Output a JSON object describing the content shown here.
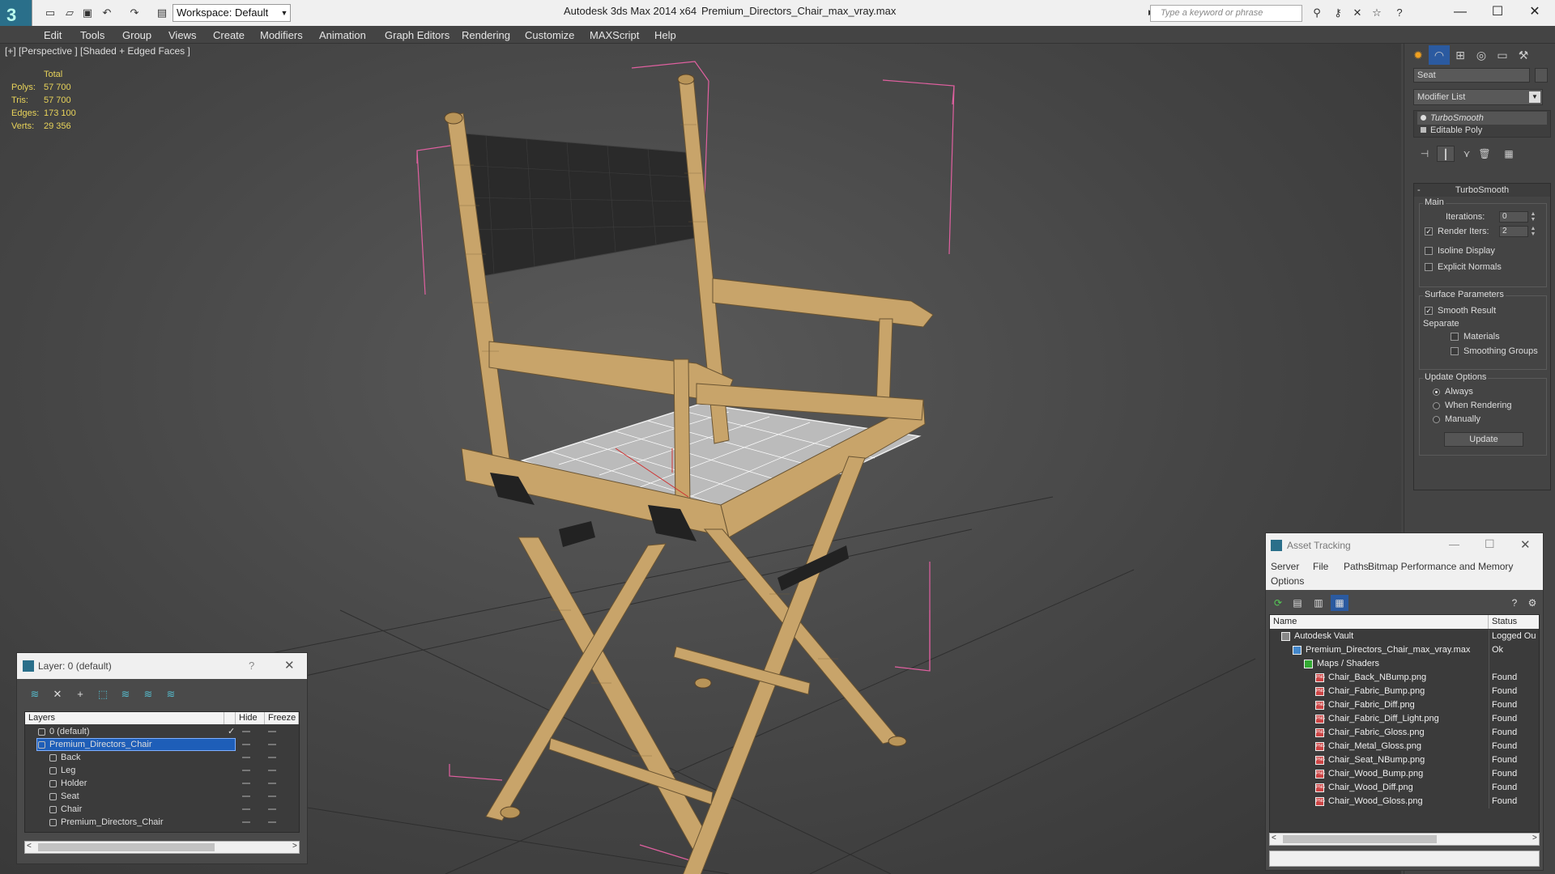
{
  "titlebar": {
    "workspace": "Workspace: Default",
    "app_title": "Autodesk 3ds Max  2014 x64",
    "file_title": "Premium_Directors_Chair_max_vray.max",
    "search_placeholder": "Type a keyword or phrase"
  },
  "menu": [
    "Edit",
    "Tools",
    "Group",
    "Views",
    "Create",
    "Modifiers",
    "Animation",
    "Graph Editors",
    "Rendering",
    "Customize",
    "MAXScript",
    "Help"
  ],
  "viewport": {
    "label": "[+] [Perspective ] [Shaded + Edged Faces ]",
    "stats": {
      "header": "Total",
      "rows": [
        {
          "label": "Polys:",
          "value": "57 700"
        },
        {
          "label": "Tris:",
          "value": "57 700"
        },
        {
          "label": "Edges:",
          "value": "173 100"
        },
        {
          "label": "Verts:",
          "value": "29 356"
        }
      ]
    }
  },
  "command_panel": {
    "object_name": "Seat",
    "modifier_list": "Modifier List",
    "stack": [
      "TurboSmooth",
      "Editable Poly"
    ],
    "turbosmooth": {
      "title": "TurboSmooth",
      "main_label": "Main",
      "iterations_label": "Iterations:",
      "iterations_value": "0",
      "render_iters_label": "Render Iters:",
      "render_iters_value": "2",
      "render_iters_checked": true,
      "isoline_label": "Isoline Display",
      "explicit_normals_label": "Explicit Normals",
      "surface_label": "Surface Parameters",
      "smooth_result_label": "Smooth Result",
      "separate_label": "Separate",
      "materials_label": "Materials",
      "smoothing_groups_label": "Smoothing Groups",
      "update_options_label": "Update Options",
      "always_label": "Always",
      "when_rendering_label": "When Rendering",
      "manually_label": "Manually",
      "update_button": "Update"
    }
  },
  "layer_dialog": {
    "title": "Layer: 0 (default)",
    "help": "?",
    "columns": [
      "Layers",
      "Hide",
      "Freeze"
    ],
    "rows": [
      {
        "name": "0 (default)",
        "indent": 1,
        "type": "layer"
      },
      {
        "name": "Premium_Directors_Chair",
        "indent": 1,
        "type": "layer",
        "selected": true
      },
      {
        "name": "Back",
        "indent": 2,
        "type": "object"
      },
      {
        "name": "Leg",
        "indent": 2,
        "type": "object"
      },
      {
        "name": "Holder",
        "indent": 2,
        "type": "object"
      },
      {
        "name": "Seat",
        "indent": 2,
        "type": "object"
      },
      {
        "name": "Chair",
        "indent": 2,
        "type": "object"
      },
      {
        "name": "Premium_Directors_Chair",
        "indent": 2,
        "type": "object"
      }
    ]
  },
  "asset_tracking": {
    "title": "Asset Tracking",
    "menu": [
      "Server",
      "File",
      "Paths",
      "Bitmap Performance and Memory",
      "Options"
    ],
    "columns": [
      "Name",
      "Status"
    ],
    "rows": [
      {
        "name": "Autodesk Vault",
        "status": "Logged Ou",
        "indent": 1
      },
      {
        "name": "Premium_Directors_Chair_max_vray.max",
        "status": "Ok",
        "indent": 2
      },
      {
        "name": "Maps / Shaders",
        "status": "",
        "indent": 3
      },
      {
        "name": "Chair_Back_NBump.png",
        "status": "Found",
        "indent": 4
      },
      {
        "name": "Chair_Fabric_Bump.png",
        "status": "Found",
        "indent": 4
      },
      {
        "name": "Chair_Fabric_Diff.png",
        "status": "Found",
        "indent": 4
      },
      {
        "name": "Chair_Fabric_Diff_Light.png",
        "status": "Found",
        "indent": 4
      },
      {
        "name": "Chair_Fabric_Gloss.png",
        "status": "Found",
        "indent": 4
      },
      {
        "name": "Chair_Metal_Gloss.png",
        "status": "Found",
        "indent": 4
      },
      {
        "name": "Chair_Seat_NBump.png",
        "status": "Found",
        "indent": 4
      },
      {
        "name": "Chair_Wood_Bump.png",
        "status": "Found",
        "indent": 4
      },
      {
        "name": "Chair_Wood_Diff.png",
        "status": "Found",
        "indent": 4
      },
      {
        "name": "Chair_Wood_Gloss.png",
        "status": "Found",
        "indent": 4
      }
    ]
  },
  "colors": {
    "stats": "#e8d35a",
    "selection": "#1e5eb8",
    "wood": "#c8a46a",
    "bbox": "#e060a0"
  }
}
